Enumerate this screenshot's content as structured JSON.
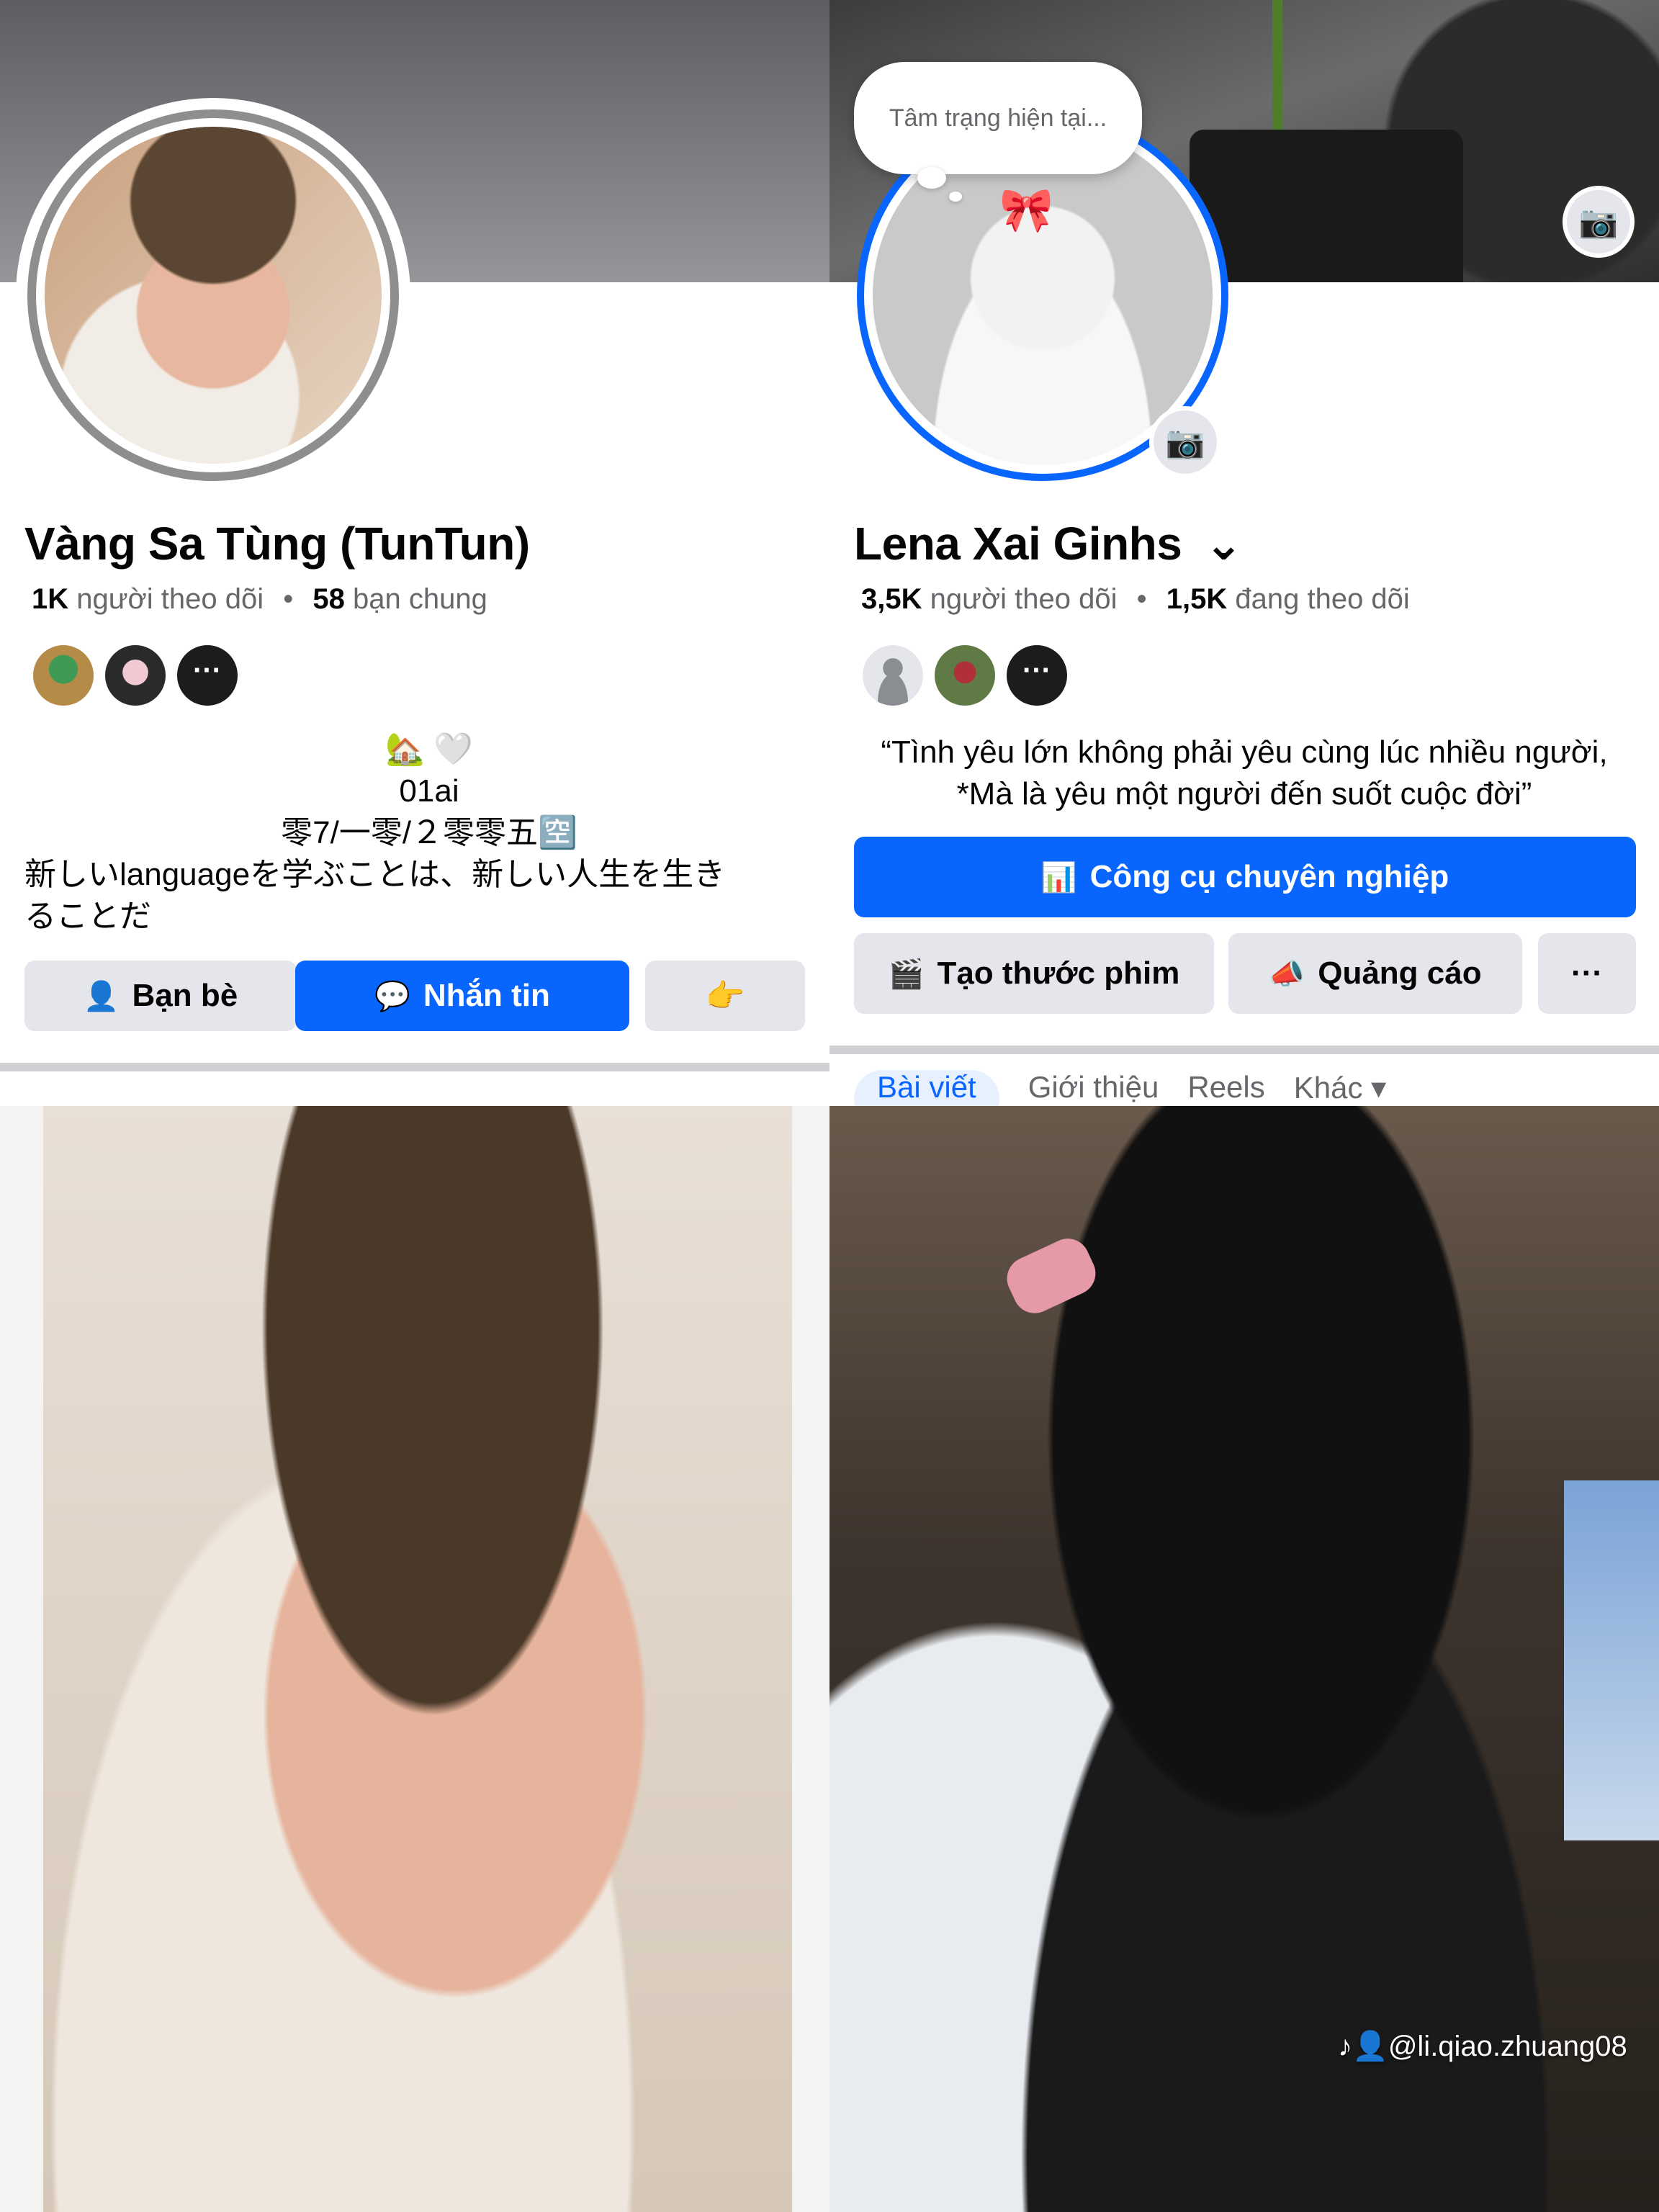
{
  "profile1": {
    "name": "Vàng Sa Tùng (TunTun)",
    "followers_count": "1K",
    "followers_label": "người theo dõi",
    "separator": "•",
    "mutual_count": "58",
    "mutual_label": "bạn chung",
    "friends_more": "···",
    "bio_line1": "🏡 🤍",
    "bio_line2": "01ai",
    "bio_line3": "零7/一零/２零零五🈳",
    "bio_line4": "新しいlanguageを学ぶことは、新しい人生を生き",
    "bio_line5": "ることだ",
    "friends_button": "Bạn bè",
    "message_button": "Nhắn tin",
    "more_icon": "👉"
  },
  "profile2": {
    "status_placeholder": "Tâm trạng hiện tại...",
    "name": "Lena Xai Ginhs",
    "name_chevron": "⌄",
    "followers_count": "3,5K",
    "followers_label": "người theo dõi",
    "separator": "•",
    "following_count": "1,5K",
    "following_label": "đang theo dõi",
    "friends_more": "···",
    "quote_line1": "“Tình yêu lớn không phải yêu cùng lúc nhiều người,",
    "quote_line2": "*Mà là yêu một người đến suốt cuộc đời”",
    "pro_tools_button": "Công cụ chuyên nghiệp",
    "create_reel_button": "Tạo thước phim",
    "ads_button": "Quảng cáo",
    "more_button": "···",
    "tabs": [
      "Bài viết",
      "Giới thiệu",
      "Reels",
      "Khác ▾"
    ]
  },
  "photo2": {
    "watermark": "@li.qiao.zhuang08"
  },
  "colors": {
    "accent": "#0866ff",
    "button_grey": "#e4e6eb",
    "secondary_text": "#65676b"
  }
}
